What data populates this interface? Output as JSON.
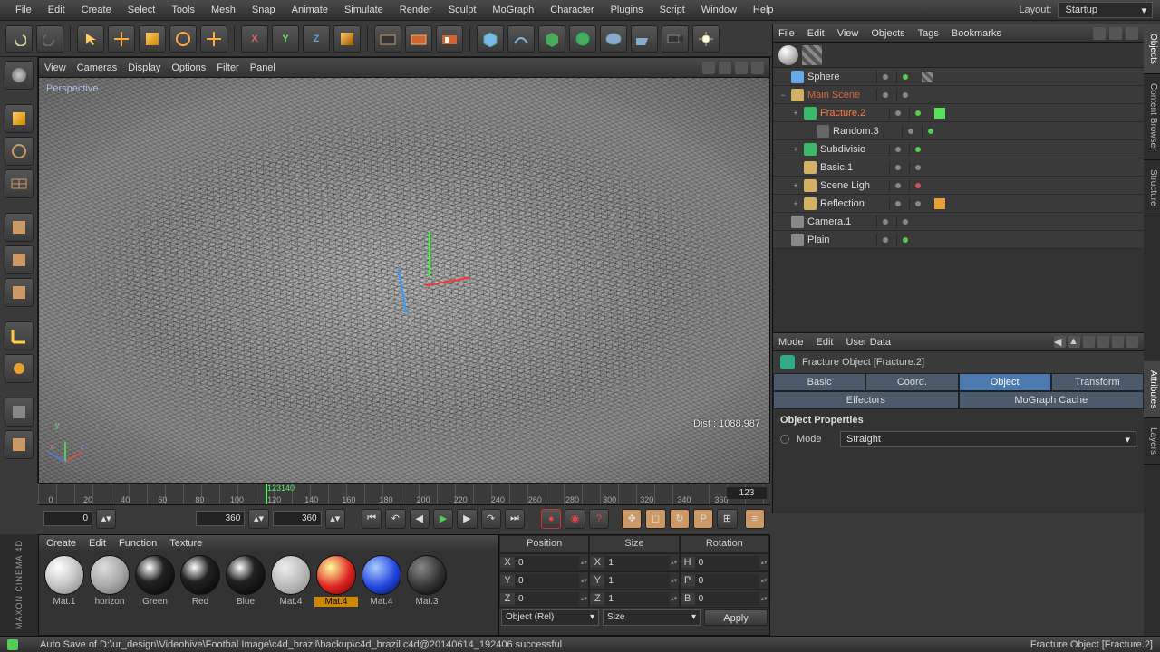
{
  "menubar": [
    "File",
    "Edit",
    "Create",
    "Select",
    "Tools",
    "Mesh",
    "Snap",
    "Animate",
    "Simulate",
    "Render",
    "Sculpt",
    "MoGraph",
    "Character",
    "Plugins",
    "Script",
    "Window",
    "Help"
  ],
  "layout": {
    "label": "Layout:",
    "value": "Startup"
  },
  "viewport": {
    "menu": [
      "View",
      "Cameras",
      "Display",
      "Options",
      "Filter",
      "Panel"
    ],
    "label": "Perspective",
    "dist": "Dist : 1088.987"
  },
  "objects_panel": {
    "menu": [
      "File",
      "Edit",
      "View",
      "Objects",
      "Tags",
      "Bookmarks"
    ],
    "items": [
      {
        "name": "Sphere",
        "indent": 0,
        "expander": "",
        "icon": "#6aa9e8",
        "dots": [
          "gray",
          "green"
        ],
        "tags": [
          "texture"
        ]
      },
      {
        "name": "Main Scene",
        "indent": 0,
        "expander": "−",
        "icon": "#d4b264",
        "dots": [
          "gray"
        ],
        "selected": false,
        "hl": "#d46a3a"
      },
      {
        "name": "Fracture.2",
        "indent": 1,
        "expander": "+",
        "icon": "#3cb86a",
        "dots": [
          "gray",
          "green"
        ],
        "selected": true,
        "tagcolor": "#58e258"
      },
      {
        "name": "Random.3",
        "indent": 2,
        "expander": "",
        "icon": "#666",
        "dots": [
          "gray",
          "green"
        ]
      },
      {
        "name": "Subdivisio",
        "indent": 1,
        "expander": "+",
        "icon": "#3cb86a",
        "dots": [
          "gray",
          "green"
        ]
      },
      {
        "name": "Basic.1",
        "indent": 1,
        "expander": "",
        "icon": "#d4b264",
        "dots": [
          "gray"
        ]
      },
      {
        "name": "Scene Ligh",
        "indent": 1,
        "expander": "+",
        "icon": "#d4b264",
        "dots": [
          "gray",
          "red"
        ]
      },
      {
        "name": "Reflection",
        "indent": 1,
        "expander": "+",
        "icon": "#d4b264",
        "dots": [
          "gray"
        ],
        "tagcolor": "#e8a030"
      },
      {
        "name": "Camera.1",
        "indent": 0,
        "expander": "",
        "icon": "#888",
        "dots": [
          "gray",
          "gray"
        ]
      },
      {
        "name": "Plain",
        "indent": 0,
        "expander": "",
        "icon": "#888",
        "dots": [
          "gray",
          "green"
        ]
      }
    ]
  },
  "vtabs": [
    "Objects",
    "Content Browser",
    "Structure",
    "Attributes",
    "Layers"
  ],
  "attributes": {
    "menu": [
      "Mode",
      "Edit",
      "User Data"
    ],
    "title": "Fracture Object [Fracture.2]",
    "tabs": [
      "Basic",
      "Coord.",
      "Object",
      "Transform",
      "Effectors",
      "MoGraph Cache"
    ],
    "active_tab": 2,
    "section": "Object Properties",
    "mode_label": "Mode",
    "mode_value": "Straight"
  },
  "timeline": {
    "marks": [
      0,
      20,
      40,
      60,
      80,
      100,
      120,
      140,
      160,
      180,
      200,
      220,
      240,
      260,
      280,
      300,
      320,
      340,
      360
    ],
    "playhead_text": "123140",
    "playhead_frame": 123,
    "current_field": "123"
  },
  "transport": {
    "start_frame": "0",
    "end_frame": "360",
    "cur_frame": "360"
  },
  "materials": {
    "menu": [
      "Create",
      "Edit",
      "Function",
      "Texture"
    ],
    "items": [
      {
        "name": "Mat.1",
        "color": "radial-gradient(circle at 35% 30%, #fff, #ccc 45%, #999 80%)"
      },
      {
        "name": "horizon",
        "color": "radial-gradient(circle at 35% 30%, #ddd, #aaa 50%, #666)"
      },
      {
        "name": "Green",
        "color": "radial-gradient(circle at 35% 30%, #fff, #222 40%, #000)"
      },
      {
        "name": "Red",
        "color": "radial-gradient(circle at 35% 30%, #fff, #222 40%, #000)"
      },
      {
        "name": "Blue",
        "color": "radial-gradient(circle at 35% 30%, #fff, #222 40%, #000)"
      },
      {
        "name": "Mat.4",
        "color": "radial-gradient(circle at 35% 30%, #eee, #bbb 50%, #888)"
      },
      {
        "name": "Mat.4",
        "color": "radial-gradient(circle at 35% 30%, #ff9, #d22 55%, #600)",
        "selected": true
      },
      {
        "name": "Mat.4",
        "color": "radial-gradient(circle at 35% 30%, #acf, #24d 55%, #014)"
      },
      {
        "name": "Mat.3",
        "color": "radial-gradient(circle at 35% 30%, #888, #333 55%, #000)"
      }
    ]
  },
  "coords": {
    "headers": [
      "Position",
      "Size",
      "Rotation"
    ],
    "rows": [
      {
        "a": "X",
        "av": "0",
        "b": "X",
        "bv": "1",
        "c": "H",
        "cv": "0"
      },
      {
        "a": "Y",
        "av": "0",
        "b": "Y",
        "bv": "1",
        "c": "P",
        "cv": "0"
      },
      {
        "a": "Z",
        "av": "0",
        "b": "Z",
        "bv": "1",
        "c": "B",
        "cv": "0"
      }
    ],
    "sel1": "Object (Rel)",
    "sel2": "Size",
    "apply": "Apply"
  },
  "status": {
    "msg": "Auto Save of D:\\ur_design\\Videohive\\Footbal Image\\c4d_brazil\\backup\\c4d_brazil.c4d@20140614_192406 successful",
    "sel": "Fracture Object [Fracture.2]"
  },
  "brand": "MAXON CINEMA 4D"
}
